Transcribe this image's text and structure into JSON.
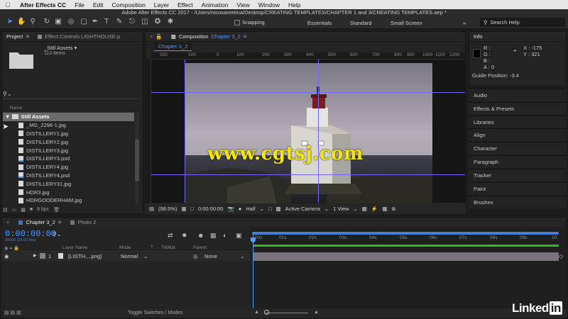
{
  "menubar": {
    "app": "After Effects CC",
    "items": [
      "File",
      "Edit",
      "Composition",
      "Layer",
      "Effect",
      "Animation",
      "View",
      "Window",
      "Help"
    ]
  },
  "titlebar": {
    "title": "Adobe After Effects CC 2017 - /Users/nicosanretina/Desktop/CREATING TEMPLATES/CHAPTER 1 and 3/CREATING TEMPLATES.aep *"
  },
  "toolbar": {
    "snapping_label": "Snapping",
    "workspaces": [
      "Essentials",
      "Standard",
      "Small Screen"
    ],
    "search_placeholder": "Search Help"
  },
  "project": {
    "tab_label": "Project",
    "effect_controls_tab": "Effect Controls LIGHTHOUSE.p",
    "selected_name": "_Still Assets ▾",
    "selected_used": "113 items",
    "column_name": "Name",
    "folder_label": "Still Assets",
    "items": [
      {
        "name": "_MG_2298-1.jpg",
        "type": "jpg"
      },
      {
        "name": "DISTILLERY1.jpg",
        "type": "jpg"
      },
      {
        "name": "DISTILLERY2.jpg",
        "type": "jpg"
      },
      {
        "name": "DISTILLERY3.jpg",
        "type": "jpg"
      },
      {
        "name": "DISTILLERY3.psd",
        "type": "psd"
      },
      {
        "name": "DISTILLERY4.jpg",
        "type": "jpg"
      },
      {
        "name": "DISTILLERY4.psd",
        "type": "psd"
      },
      {
        "name": "DISTILLERY31.jpg",
        "type": "jpg"
      },
      {
        "name": "HDR3.jpg",
        "type": "jpg"
      },
      {
        "name": "HDRGOODERHAM.jpg",
        "type": "jpg"
      }
    ],
    "bpc": "8 bpc"
  },
  "composition": {
    "tab_prefix": "Composition",
    "tab_name": "Chapter 3_2",
    "breadcrumb": "Chapter 3_2",
    "ruler_ticks": [
      "200",
      "100",
      "0",
      "100",
      "200",
      "300",
      "400",
      "500",
      "600",
      "700",
      "800",
      "900",
      "1000",
      "1100",
      "1175",
      "1200"
    ],
    "watermark": "www.cgtsj.com",
    "zoom": "(58.5%)",
    "timecode": "0:00:00:00",
    "resolution": "Half",
    "camera": "Active Camera",
    "views": "1 View"
  },
  "info": {
    "tab": "Info",
    "r": "R :",
    "g": "G :",
    "b": "B :",
    "a": "A : 0",
    "x": "X : -175",
    "y": "Y : 321",
    "guide_position": "Guide Position: -3.4"
  },
  "right_panels": [
    "Audio",
    "Effects & Presets",
    "Libraries",
    "Align",
    "Character",
    "Paragraph",
    "Tracker",
    "Paint",
    "Brushes"
  ],
  "timeline": {
    "tabs": [
      "Chapter 3_2",
      "Photo 2"
    ],
    "timecode": "0:00:00:00",
    "fps": "00000 (25.00 fps)",
    "headers": {
      "layer_name": "Layer Name",
      "mode": "Mode",
      "t": "T",
      "trkmat": "TrkMat",
      "parent": "Parent"
    },
    "layer": {
      "index": "1",
      "name": "[LIGTH....png]",
      "mode": "Normal",
      "parent": "None"
    },
    "ruler": [
      "00s",
      "01s",
      "02s",
      "03s",
      "04s",
      "05s",
      "06s",
      "07s",
      "08s",
      "09s",
      "10"
    ],
    "toggle_label": "Toggle Switches / Modes"
  },
  "watermark_logo": "Linked",
  "watermark_logo_in": "in"
}
